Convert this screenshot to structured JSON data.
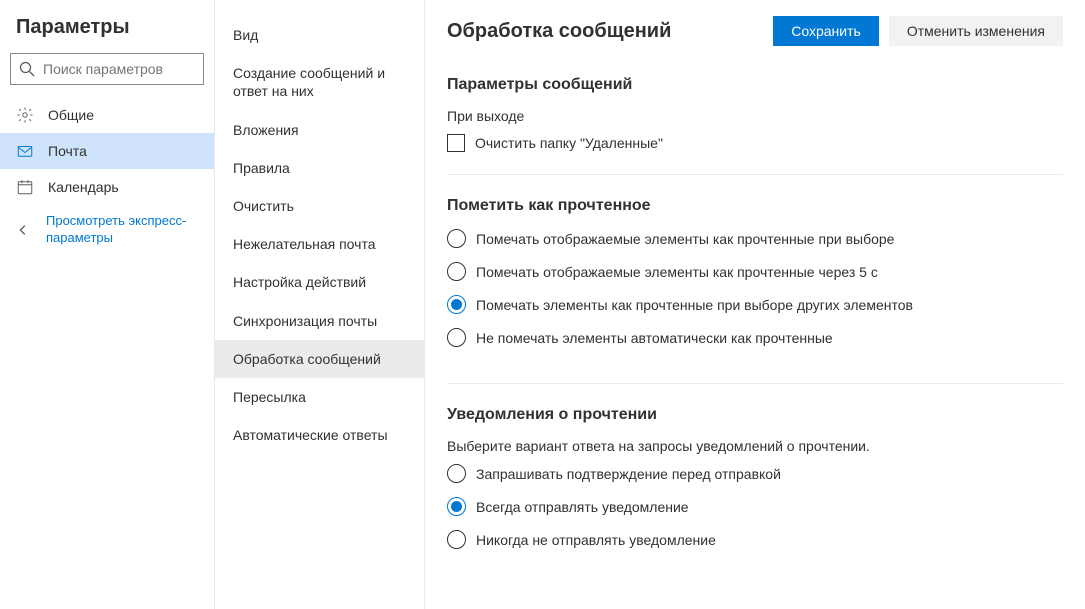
{
  "left": {
    "title": "Параметры",
    "search_placeholder": "Поиск параметров",
    "general": "Общие",
    "mail": "Почта",
    "calendar": "Календарь",
    "quick_link": "Просмотреть экспресс-параметры"
  },
  "mid": {
    "items": [
      "Вид",
      "Создание сообщений и ответ на них",
      "Вложения",
      "Правила",
      "Очистить",
      "Нежелательная почта",
      "Настройка действий",
      "Синхронизация почты",
      "Обработка сообщений",
      "Пересылка",
      "Автоматические ответы"
    ],
    "active_index": 8
  },
  "right": {
    "title": "Обработка сообщений",
    "save": "Сохранить",
    "cancel": "Отменить изменения",
    "sec1": {
      "heading": "Параметры сообщений",
      "label": "При выходе",
      "checkbox": "Очистить папку \"Удаленные\""
    },
    "sec2": {
      "heading": "Пометить как прочтенное",
      "options": [
        "Помечать отображаемые элементы как прочтенные при выборе",
        "Помечать отображаемые элементы как прочтенные через 5 с",
        "Помечать элементы как прочтенные при выборе других элементов",
        "Не помечать элементы автоматически как прочтенные"
      ],
      "selected_index": 2
    },
    "sec3": {
      "heading": "Уведомления о прочтении",
      "desc": "Выберите вариант ответа на запросы уведомлений о прочтении.",
      "options": [
        "Запрашивать подтверждение перед отправкой",
        "Всегда отправлять уведомление",
        "Никогда не отправлять уведомление"
      ],
      "selected_index": 1
    }
  }
}
